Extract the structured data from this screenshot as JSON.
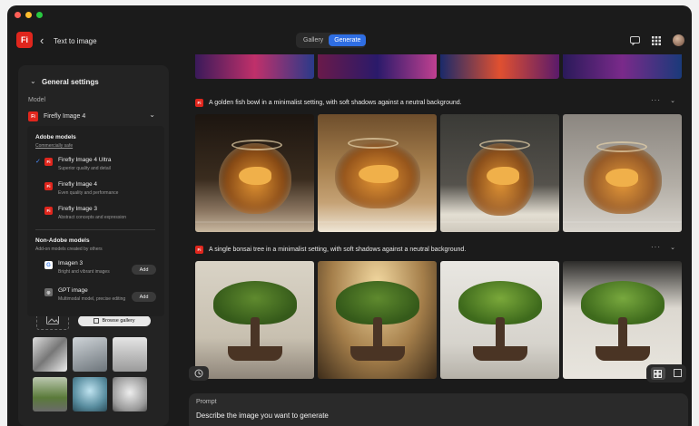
{
  "app": {
    "logo_text": "Fi",
    "page_title": "Text to image"
  },
  "header": {
    "tabs": [
      {
        "label": "Gallery",
        "active": false
      },
      {
        "label": "Generate",
        "active": true
      }
    ],
    "icons": [
      "chat-feedback-icon",
      "app-grid-icon",
      "user-avatar"
    ]
  },
  "sidebar": {
    "section_title": "General settings",
    "model_label": "Model",
    "selected_model": "Firefly Image 4",
    "browse_gallery_label": "Browse gallery"
  },
  "model_dropdown": {
    "adobe_group_title": "Adobe models",
    "adobe_group_sub": "Commercially safe",
    "adobe_models": [
      {
        "name": "Firefly Image 4 Ultra",
        "desc": "Superior quality and detail",
        "selected": true
      },
      {
        "name": "Firefly Image 4",
        "desc": "Even quality and performance",
        "selected": false
      },
      {
        "name": "Firefly Image 3",
        "desc": "Abstract concepts and expression",
        "selected": false
      }
    ],
    "nonadobe_group_title": "Non-Adobe models",
    "nonadobe_group_sub": "Add-on models created by others",
    "nonadobe_models": [
      {
        "name": "Imagen 3",
        "desc": "Bright and vibrant images",
        "action": "Add"
      },
      {
        "name": "GPT image",
        "desc": "Multimodal model, precise editing",
        "action": "Add"
      }
    ]
  },
  "results": [
    {
      "prompt": "A golden fish bowl in a minimalist setting, with soft shadows against a neutral background.",
      "more_label": "···",
      "caret": "⌄"
    },
    {
      "prompt": "A single bonsai tree in a minimalist setting, with soft shadows against a neutral background.",
      "more_label": "···",
      "caret": "⌄"
    }
  ],
  "prompt_panel": {
    "label": "Prompt",
    "placeholder": "Describe the image you want to generate"
  },
  "colors": {
    "brand_red": "#e0261d",
    "accent_blue": "#2f6ee3",
    "background": "#1b1b1b"
  }
}
